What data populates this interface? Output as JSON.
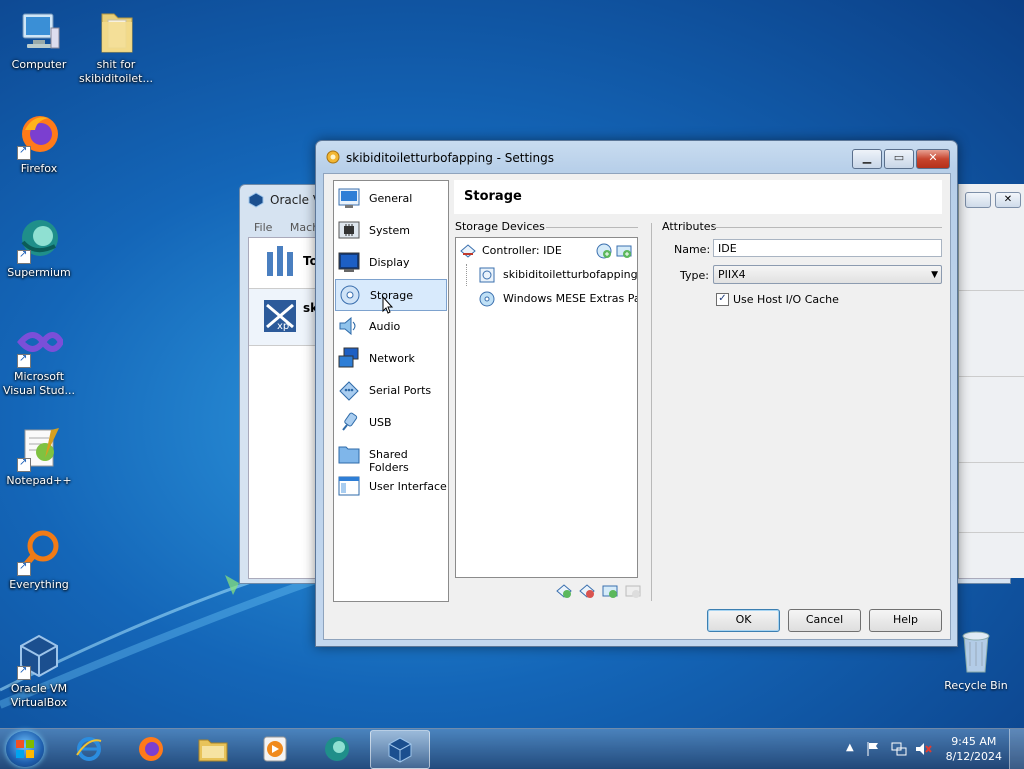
{
  "desktop": {
    "icons": [
      {
        "label": "Computer"
      },
      {
        "label": "shit for\nskibiditoilet..."
      },
      {
        "label": "Firefox"
      },
      {
        "label": "Supermium"
      },
      {
        "label": "Microsoft\nVisual Stud..."
      },
      {
        "label": "Notepad++"
      },
      {
        "label": "Everything"
      },
      {
        "label": "Oracle VM\nVirtualBox"
      }
    ],
    "recycle_bin": "Recycle Bin"
  },
  "background_window": {
    "title": "Oracle VI",
    "menu": [
      "File",
      "Machi"
    ],
    "tools_label": "To",
    "vm_label": "sk"
  },
  "settings_dialog": {
    "title": "skibiditoiletturbofapping - Settings",
    "categories": [
      {
        "label": "General"
      },
      {
        "label": "System"
      },
      {
        "label": "Display"
      },
      {
        "label": "Storage",
        "selected": true
      },
      {
        "label": "Audio"
      },
      {
        "label": "Network"
      },
      {
        "label": "Serial Ports"
      },
      {
        "label": "USB"
      },
      {
        "label": "Shared Folders"
      },
      {
        "label": "User Interface"
      }
    ],
    "page_title": "Storage",
    "storage_devices_label": "Storage Devices",
    "tree": {
      "controller": "Controller: IDE",
      "items": [
        "skibiditoiletturbofapping....",
        "Windows MESE Extras Pa..."
      ]
    },
    "attributes_label": "Attributes",
    "name_label": "Name:",
    "name_value": "IDE",
    "type_label": "Type:",
    "type_value": "PIIX4",
    "host_io_cache_label": "Use Host I/O Cache",
    "host_io_cache_checked": true,
    "buttons": {
      "ok": "OK",
      "cancel": "Cancel",
      "help": "Help"
    }
  },
  "taskbar": {
    "time": "9:45 AM",
    "date": "8/12/2024"
  },
  "colors": {
    "accent": "#3c7fb1",
    "selection": "#d8eafc"
  }
}
